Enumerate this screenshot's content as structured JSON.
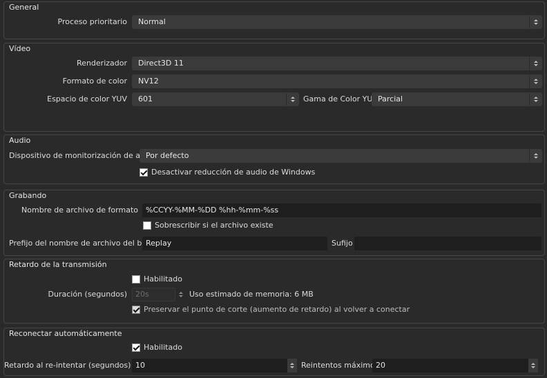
{
  "general": {
    "title": "General",
    "priority_label": "Proceso prioritario",
    "priority_value": "Normal"
  },
  "video": {
    "title": "Vídeo",
    "renderer_label": "Renderizador",
    "renderer_value": "Direct3D 11",
    "color_format_label": "Formato de color",
    "color_format_value": "NV12",
    "yuv_space_label": "Espacio de color YUV",
    "yuv_space_value": "601",
    "yuv_range_label": "Gama de Color YUV",
    "yuv_range_value": "Parcial"
  },
  "audio": {
    "title": "Audio",
    "monitor_device_label": "Dispositivo de monitorización de audio",
    "monitor_device_value": "Por defecto",
    "disable_ducking_label": "Desactivar reducción de audio de Windows",
    "disable_ducking_checked": true
  },
  "recording": {
    "title": "Grabando",
    "filename_format_label": "Nombre de archivo de formato",
    "filename_format_value": "%CCYY-%MM-%DD %hh-%mm-%ss",
    "overwrite_label": "Sobrescribir si el archivo existe",
    "overwrite_checked": false,
    "buffer_prefix_label": "Prefijo del nombre de archivo del búfer",
    "buffer_prefix_value": "Replay",
    "suffix_label": "Sufijo",
    "suffix_value": ""
  },
  "stream_delay": {
    "title": "Retardo de la transmisión",
    "enabled_label": "Habilitado",
    "enabled_checked": false,
    "duration_label": "Duración (segundos)",
    "duration_value": "20s",
    "memory_usage_label": "Uso estimado de memoria: 6 MB",
    "preserve_label": "Preservar el punto de corte (aumento de retardo) al volver a conectar",
    "preserve_checked": true
  },
  "reconnect": {
    "title": "Reconectar automáticamente",
    "enabled_label": "Habilitado",
    "enabled_checked": true,
    "retry_delay_label": "Retardo al re-intentar (segundos)",
    "retry_delay_value": "10",
    "max_retries_label": "Reintentos máximos",
    "max_retries_value": "20"
  }
}
